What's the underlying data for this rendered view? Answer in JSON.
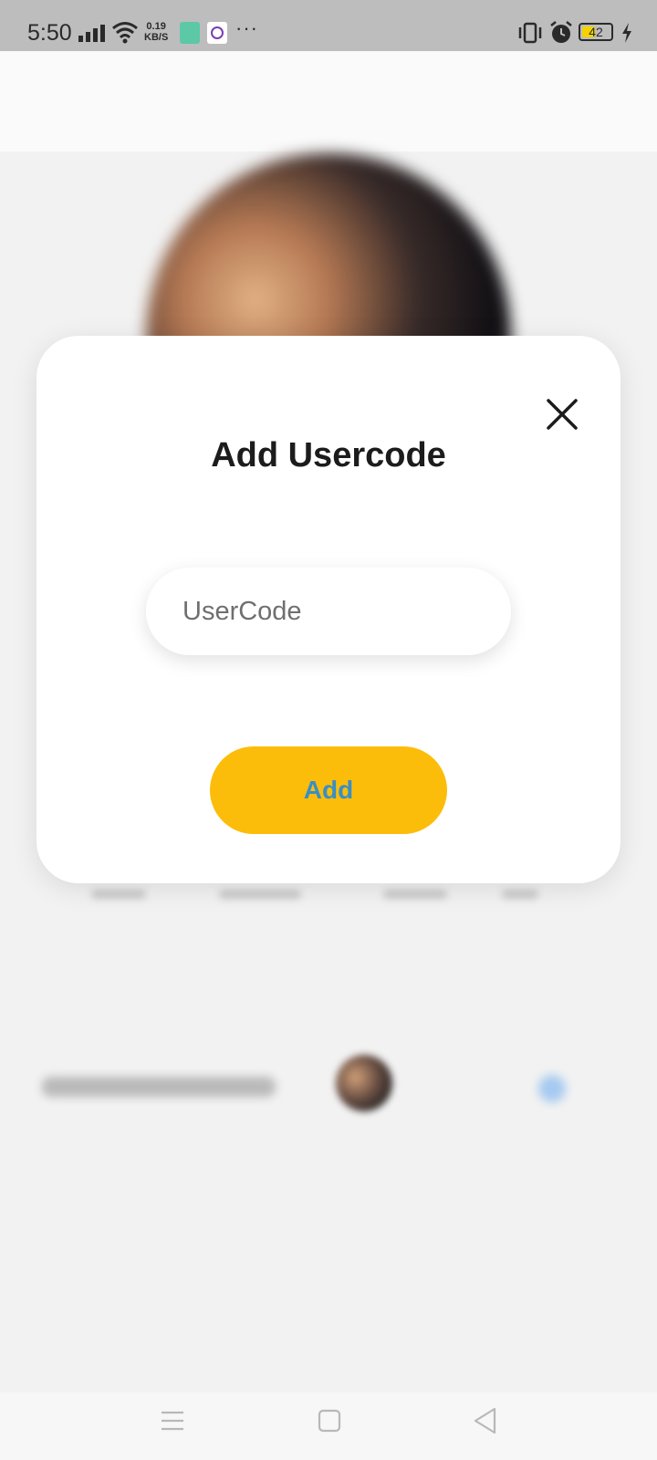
{
  "status_bar": {
    "time": "5:50",
    "net_speed_value": "0.19",
    "net_speed_unit": "KB/S",
    "battery_level": "42",
    "icons": [
      "signal-icon",
      "wifi-icon",
      "app-notification-icon",
      "app-notification-icon",
      "more-icon",
      "vibrate-icon",
      "alarm-icon",
      "battery-icon",
      "charging-icon"
    ]
  },
  "dialog": {
    "title": "Add Usercode",
    "input_placeholder": "UserCode",
    "input_value": "",
    "add_label": "Add",
    "close_icon": "close-icon"
  },
  "nav_bar": {
    "icons": [
      "menu-icon",
      "home-icon",
      "back-icon"
    ]
  },
  "colors": {
    "accent_button": "#fcbd0a",
    "button_text": "#3a8fc4",
    "status_bar_bg": "#bdbdbd"
  }
}
